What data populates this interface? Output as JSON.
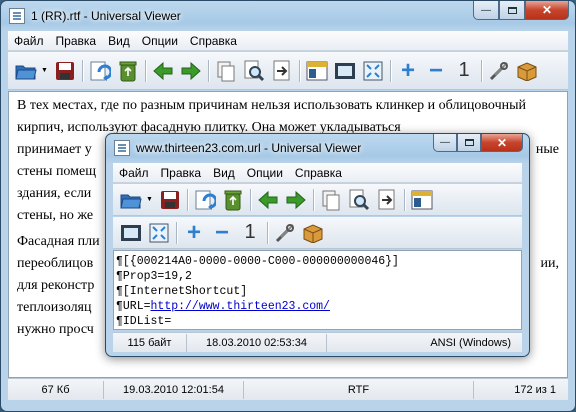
{
  "back_window": {
    "title": "1 (RR).rtf - Universal Viewer",
    "menu": [
      "Файл",
      "Правка",
      "Вид",
      "Опции",
      "Справка"
    ],
    "paragraph1": "В тех местах, где по разным причинам нельзя использовать клинкер и облицовочный кирпич, используют фасадную плитку.  Она может укладываться",
    "line3_tail": "",
    "line4_start": "принимает у",
    "line4_end": "ные",
    "line5_start": "стены помещ",
    "line6_start": "здания, если",
    "line7_start": "стены, но же",
    "para2_line1_start": "Фасадная пли",
    "para2_line2_start": "переоблицов",
    "para2_line2_end": "ии,",
    "para2_line3_start": "для реконстр",
    "para2_line4_start": "теплоизоляц",
    "para2_line5_start": "нужно просч",
    "status": {
      "size": "67 Кб",
      "date": "19.03.2010 12:01:54",
      "format": "RTF",
      "position": "172 из 1"
    }
  },
  "front_window": {
    "title": "www.thirteen23.com.url - Universal Viewer",
    "menu": [
      "Файл",
      "Правка",
      "Вид",
      "Опции",
      "Справка"
    ],
    "lines": [
      "[{000214A0-0000-0000-C000-000000000046}]",
      "Prop3=19,2",
      "[InternetShortcut]",
      "URL=",
      "IDList="
    ],
    "url": "http://www.thirteen23.com/",
    "status": {
      "size": "115 байт",
      "date": "18.03.2010 02:53:34",
      "encoding": "ANSI (Windows)"
    }
  },
  "colors": {
    "accent": "#2e7fd0",
    "green_arrow": "#3a9a2a",
    "close": "#c7442c"
  }
}
